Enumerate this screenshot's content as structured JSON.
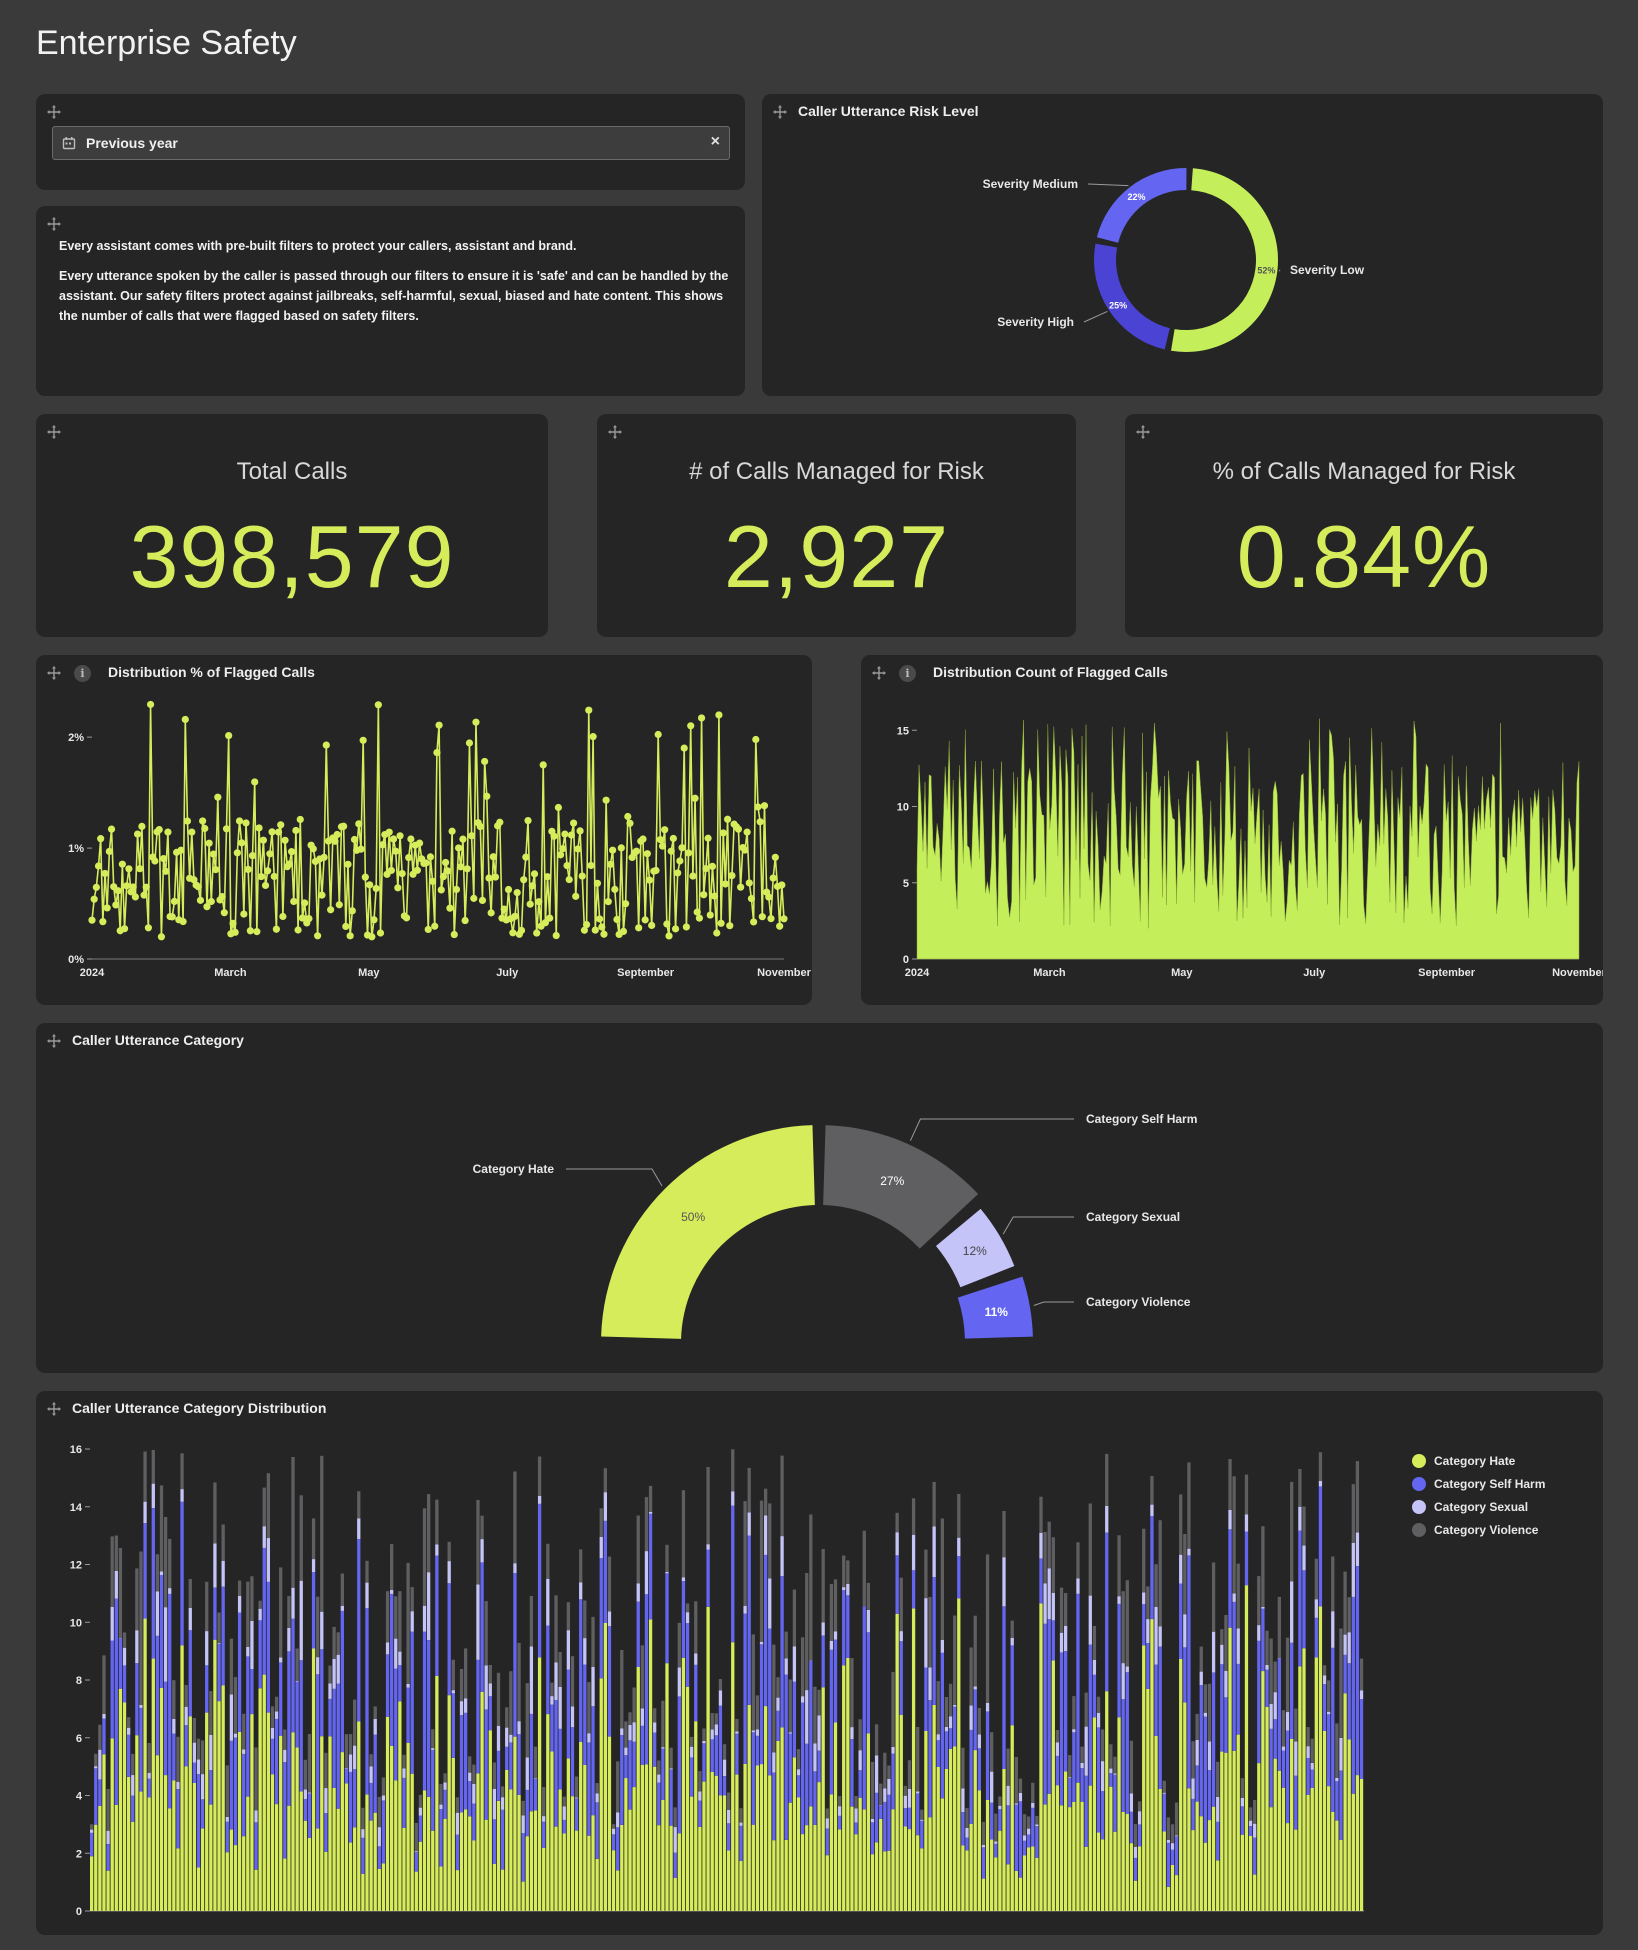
{
  "page": {
    "title": "Enterprise Safety"
  },
  "colors": {
    "lime": "#d6ec5b",
    "lime_bright": "#c5ee5b",
    "purple": "#6466f1",
    "purple_dark": "#4b43d3",
    "lavender": "#c5c4f8",
    "gray": "#5f5f62",
    "card_bg": "#252525",
    "page_bg": "#3a3a3a"
  },
  "icons": {
    "move": "move-icon",
    "info": "info-icon",
    "calendar": "calendar-icon",
    "clear": "close-icon"
  },
  "filter": {
    "label": "Previous year",
    "clear_glyph": "×"
  },
  "description": {
    "p1": "Every assistant comes with pre-built filters to protect your callers, assistant and brand.",
    "p2": "Every utterance spoken by the caller is passed through our filters to ensure it is 'safe' and can be handled by the assistant. Our safety filters protect against jailbreaks, self-harmful, sexual, biased and hate content.  This shows the number of calls that were flagged based on safety filters."
  },
  "kpis": [
    {
      "label": "Total Calls",
      "value": "398,579"
    },
    {
      "label": "# of Calls Managed for Risk",
      "value": "2,927"
    },
    {
      "label": "% of Calls Managed for Risk",
      "value": "0.84%"
    }
  ],
  "chart_data": [
    {
      "id": "risk-level",
      "type": "pie",
      "title": "Caller Utterance Risk Level",
      "slices": [
        {
          "name": "Severity Low",
          "value": 52,
          "label": "52%",
          "color": "#c5ee5b"
        },
        {
          "name": "Severity High",
          "value": 25,
          "label": "25%",
          "color": "#4b43d3"
        },
        {
          "name": "Severity Medium",
          "value": 22,
          "label": "22%",
          "color": "#6466f1"
        }
      ]
    },
    {
      "id": "flagged-pct",
      "type": "line",
      "title": "Distribution % of Flagged Calls",
      "x_ticks": [
        "2024",
        "March",
        "May",
        "July",
        "September",
        "November"
      ],
      "y_ticks": [
        "0%",
        "1%",
        "2%"
      ],
      "ylim": [
        0,
        2.2
      ],
      "seed": 7,
      "n_points": 320,
      "value_range_pct": [
        0.2,
        2.3
      ]
    },
    {
      "id": "flagged-count",
      "type": "area",
      "title": "Distribution Count of Flagged Calls",
      "x_ticks": [
        "2024",
        "March",
        "May",
        "July",
        "September",
        "November"
      ],
      "y_ticks": [
        "0",
        "5",
        "10",
        "15"
      ],
      "ylim": [
        0,
        16
      ],
      "seed": 13,
      "n_points": 330,
      "value_range": [
        1,
        16
      ]
    },
    {
      "id": "category",
      "type": "pie",
      "title": "Caller Utterance Category",
      "slices": [
        {
          "name": "Category Hate",
          "value": 50,
          "label": "50%",
          "color": "#d6ec5b"
        },
        {
          "name": "Category Self Harm",
          "value": 27,
          "label": "27%",
          "color": "#5f5f62"
        },
        {
          "name": "Category Sexual",
          "value": 12,
          "label": "12%",
          "color": "#c5c4f8"
        },
        {
          "name": "Category Violence",
          "value": 11,
          "label": "11%",
          "color": "#6466f1"
        }
      ]
    },
    {
      "id": "category-dist",
      "type": "bar",
      "stacked": true,
      "title": "Caller Utterance Category Distribution",
      "y_ticks": [
        "0",
        "2",
        "4",
        "6",
        "8",
        "10",
        "12",
        "14",
        "16"
      ],
      "ylim": [
        0,
        16
      ],
      "n_bars": 310,
      "seed": 21,
      "series": [
        {
          "name": "Category Hate",
          "color": "#d6ec5b"
        },
        {
          "name": "Category Self Harm",
          "color": "#6466f1"
        },
        {
          "name": "Category Sexual",
          "color": "#c5c4f8"
        },
        {
          "name": "Category Violence",
          "color": "#5f5f62"
        }
      ],
      "legend": "top-right"
    }
  ]
}
